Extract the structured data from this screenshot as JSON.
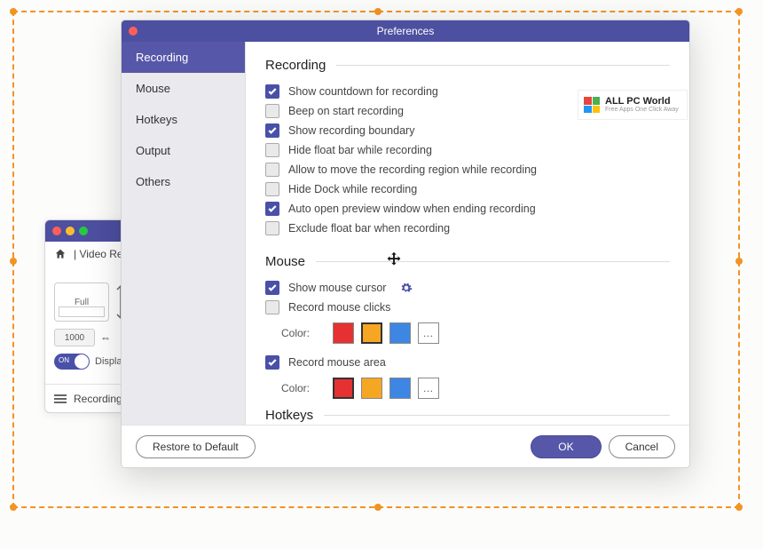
{
  "bgwin": {
    "toolbar_title": "| Video Re",
    "display_label": "Full",
    "size_value": "1000",
    "toggle_on_label": "ON",
    "toggle_caption": "Displa",
    "footer_label": "Recording"
  },
  "prefs": {
    "title": "Preferences",
    "sidebar": {
      "items": [
        {
          "label": "Recording"
        },
        {
          "label": "Mouse"
        },
        {
          "label": "Hotkeys"
        },
        {
          "label": "Output"
        },
        {
          "label": "Others"
        }
      ]
    },
    "sections": {
      "recording": {
        "title": "Recording",
        "items": [
          {
            "checked": true,
            "label": "Show countdown for recording"
          },
          {
            "checked": false,
            "label": "Beep on start recording"
          },
          {
            "checked": true,
            "label": "Show recording boundary"
          },
          {
            "checked": false,
            "label": "Hide float bar while recording"
          },
          {
            "checked": false,
            "label": "Allow to move the recording region while recording"
          },
          {
            "checked": false,
            "label": "Hide Dock while recording"
          },
          {
            "checked": true,
            "label": "Auto open preview window when ending recording"
          },
          {
            "checked": false,
            "label": "Exclude float bar when recording"
          }
        ]
      },
      "mouse": {
        "title": "Mouse",
        "show_cursor": {
          "checked": true,
          "label": "Show mouse cursor"
        },
        "record_clicks": {
          "checked": false,
          "label": "Record mouse clicks"
        },
        "record_area": {
          "checked": true,
          "label": "Record mouse area"
        },
        "color_label": "Color:",
        "more": "…"
      },
      "hotkeys": {
        "title": "Hotkeys"
      }
    },
    "logo": {
      "title": "ALL PC World",
      "subtitle": "Free Apps One Click Away"
    },
    "footer": {
      "restore": "Restore to Default",
      "ok": "OK",
      "cancel": "Cancel"
    }
  }
}
